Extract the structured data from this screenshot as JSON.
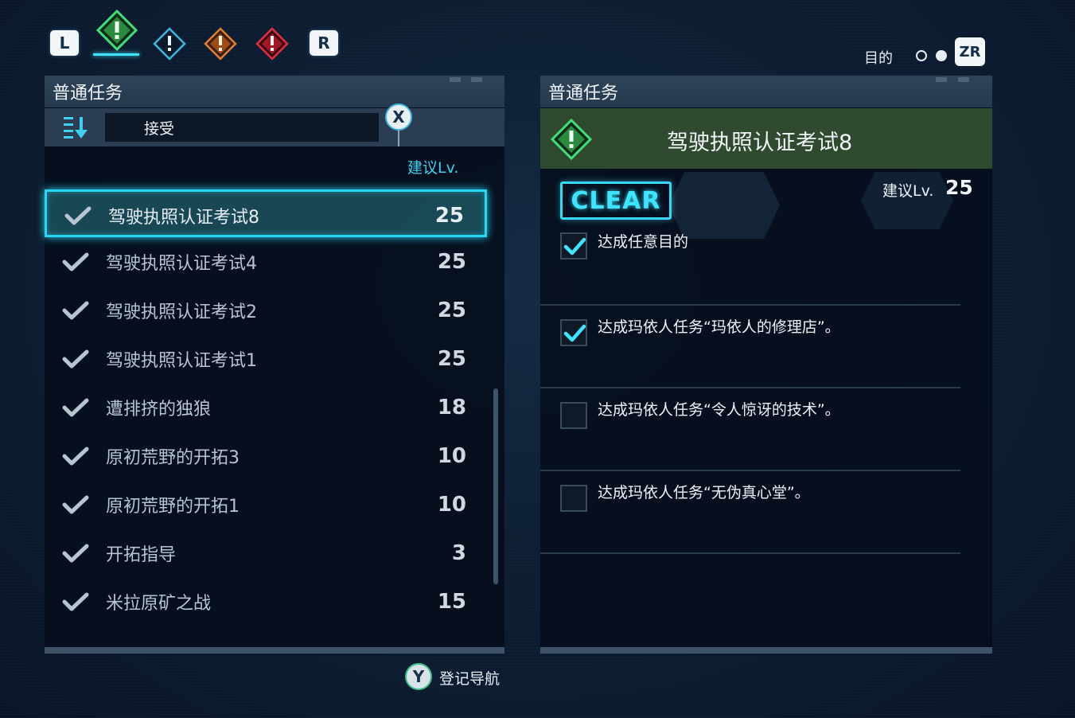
{
  "top_tabs": {
    "left_button": "L",
    "right_button": "R",
    "icons": [
      "quest-green-icon",
      "quest-blue-icon",
      "quest-orange-icon",
      "quest-red-icon"
    ]
  },
  "purpose": {
    "label": "目的",
    "zr_button": "ZR"
  },
  "left_panel": {
    "title": "普通任务",
    "sort_value": "接受",
    "close_button": "X",
    "rec_lv_header": "建议Lv.",
    "quests": [
      {
        "name": "驾驶执照认证考试8",
        "lv": "25",
        "selected": true
      },
      {
        "name": "驾驶执照认证考试4",
        "lv": "25"
      },
      {
        "name": "驾驶执照认证考试2",
        "lv": "25"
      },
      {
        "name": "驾驶执照认证考试1",
        "lv": "25"
      },
      {
        "name": "遭排挤的独狼",
        "lv": "18"
      },
      {
        "name": "原初荒野的开拓3",
        "lv": "10"
      },
      {
        "name": "原初荒野的开拓1",
        "lv": "10"
      },
      {
        "name": "开拓指导",
        "lv": "3"
      },
      {
        "name": "米拉原矿之战",
        "lv": "15"
      }
    ]
  },
  "register_nav": {
    "button": "Y",
    "label": "登记导航"
  },
  "right_panel": {
    "title": "普通任务",
    "quest_title": "驾驶执照认证考试8",
    "status_badge": "CLEAR",
    "rec_lv_label": "建议Lv.",
    "rec_lv_value": "25",
    "objectives": [
      {
        "text": "达成任意目的",
        "done": true
      },
      {
        "text": "达成玛依人任务“玛依人的修理店”。",
        "done": true
      },
      {
        "text": "达成玛依人任务“令人惊讶的技术”。",
        "done": false
      },
      {
        "text": "达成玛依人任务“无伪真心堂”。",
        "done": false
      }
    ]
  },
  "colors": {
    "accent_cyan": "#26d6f2",
    "quest_green": "#2f4a2e",
    "panel_header": "#2f4358"
  }
}
